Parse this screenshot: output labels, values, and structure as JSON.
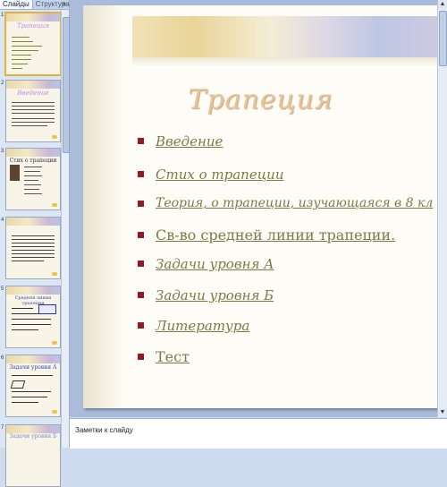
{
  "pane_tabs": {
    "slides": "Слайды",
    "outline": "Структура",
    "close_glyph": "×"
  },
  "thumbnails": [
    {
      "num": "1",
      "title": "Трапеция"
    },
    {
      "num": "2",
      "title": "Введение"
    },
    {
      "num": "3",
      "title": "Стих о трапеции"
    },
    {
      "num": "4",
      "title": ""
    },
    {
      "num": "5",
      "title": "Средняя линия трапеции"
    },
    {
      "num": "6",
      "title": "Задачи уровня А"
    },
    {
      "num": "7",
      "title": "Задачи уровня Б"
    }
  ],
  "slide": {
    "title": "Трапеция",
    "items": [
      "Введение",
      "Стих о трапеции",
      "Теория, о трапеции, изучающаяся в 8 кл",
      "Св-во средней линии трапеции.",
      "Задачи уровня А",
      "Задачи уровня Б",
      "Литература",
      "Тест"
    ],
    "colors": {
      "title": "#e7c49a",
      "bullet": "#8e1a2a",
      "link": "#7d7a48"
    }
  },
  "notes": {
    "placeholder": "Заметки к слайду"
  },
  "scrollbar": {
    "up": "▲",
    "down": "▼"
  }
}
